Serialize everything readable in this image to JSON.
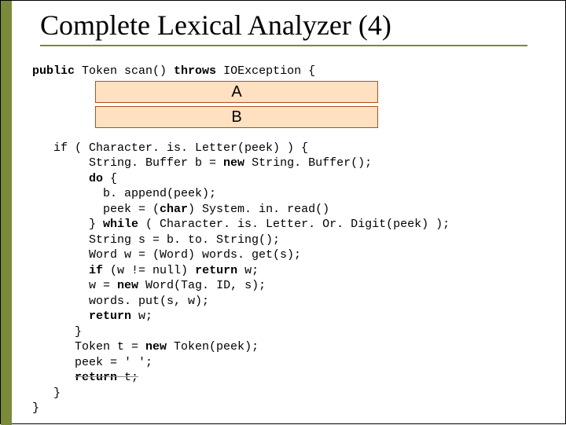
{
  "title": "Complete Lexical Analyzer (4)",
  "boxA": "A",
  "boxB": "B",
  "code": {
    "l1a": "public",
    "l1b": " Token scan() ",
    "l1c": "throws",
    "l1d": " IOException {",
    "l2": "   if ( Character. is. Letter(peek) ) {",
    "l3a": "        String. Buffer b = ",
    "l3b": "new",
    "l3c": " String. Buffer();",
    "l4a": "        ",
    "l4b": "do",
    "l4c": " {",
    "l5": "          b. append(peek);",
    "l6a": "          peek = (",
    "l6b": "char",
    "l6c": ") System. in. read()",
    "l7a": "        } ",
    "l7b": "while",
    "l7c": " ( Character. is. Letter. Or. Digit(peek) );",
    "l8": "        String s = b. to. String();",
    "l9": "        Word w = (Word) words. get(s);",
    "l10a": "        ",
    "l10b": "if",
    "l10c": " (w != null) ",
    "l10d": "return",
    "l10e": " w;",
    "l11a": "        w = ",
    "l11b": "new",
    "l11c": " Word(Tag. ID, s);",
    "l12": "        words. put(s, w);",
    "l13a": "        ",
    "l13b": "return",
    "l13c": " w;",
    "l14": "      }",
    "l15a": "      Token t = ",
    "l15b": "new",
    "l15c": " Token(peek);",
    "l16": "      peek = ' ';",
    "l17a": "      ",
    "l17b": "return",
    "l17c": " t;",
    "l18": "   }",
    "l19": "}"
  }
}
